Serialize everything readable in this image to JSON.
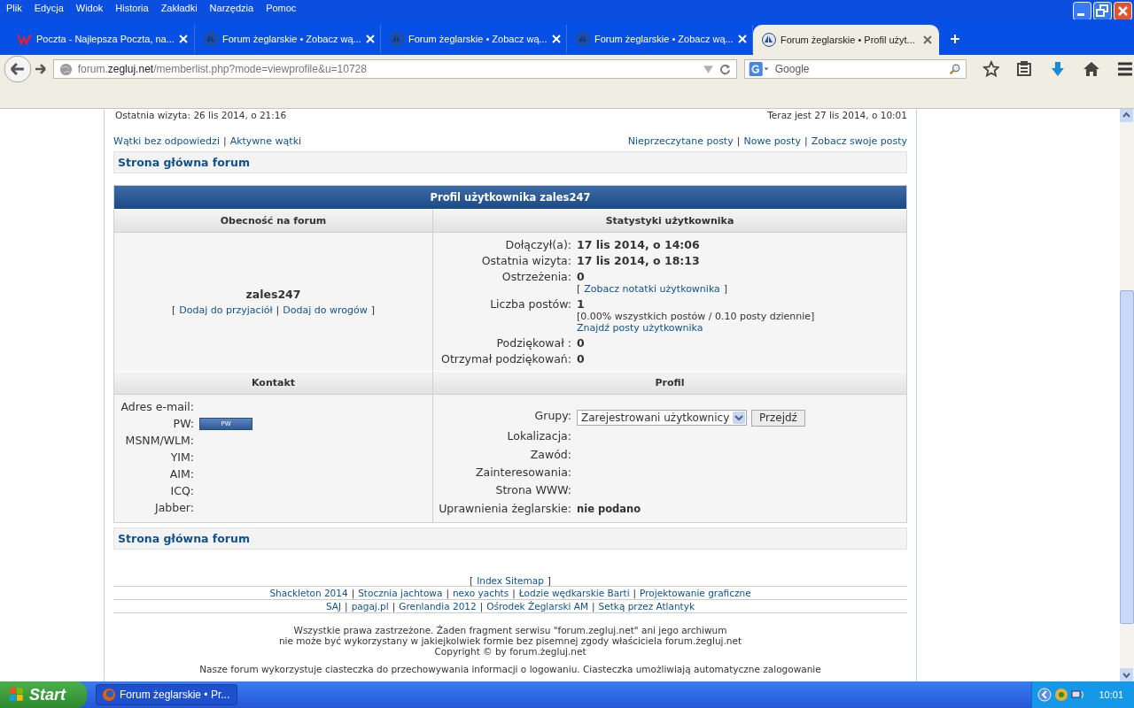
{
  "window": {
    "menu": [
      "Plik",
      "Edycja",
      "Widok",
      "Historia",
      "Zakładki",
      "Narzędzia",
      "Pomoc"
    ],
    "tabs": [
      {
        "title": "Poczta - Najlepsza Poczta, na...",
        "kind": "mail",
        "selected": false
      },
      {
        "title": "Forum żeglarskie • Zobacz wą...",
        "kind": "forum",
        "selected": false
      },
      {
        "title": "Forum żeglarskie • Zobacz wą...",
        "kind": "forum",
        "selected": false
      },
      {
        "title": "Forum żeglarskie • Zobacz wą...",
        "kind": "forum",
        "selected": false
      },
      {
        "title": "Forum żeglarskie • Profil użyt...",
        "kind": "forum",
        "selected": true
      }
    ],
    "address": {
      "prefix": "forum.",
      "domain": "zegluj.net",
      "rest": "/memberlist.php?mode=viewprofile&u=10728"
    },
    "search": {
      "placeholder": "Google"
    }
  },
  "page": {
    "last_visit": "Ostatnia wizyta: 26 lis 2014, o 21:16",
    "now": "Teraz jest 27 lis 2014, o 10:01",
    "links_left": [
      "Wątki bez odpowiedzi",
      "Aktywne wątki"
    ],
    "links_right": [
      "Nieprzeczytane posty",
      "Nowe posty",
      "Zobacz swoje posty"
    ],
    "separator": "|",
    "breadcrumb": "Strona główna forum",
    "profile": {
      "title": "Profil użytkownika zales247",
      "presence_header": "Obecność na forum",
      "stats_header": "Statystyki użytkownika",
      "username": "zales247",
      "user_links": [
        {
          "text": "[",
          "link": false
        },
        {
          "text": "Dodaj do przyjaciół",
          "link": true
        },
        {
          "text": "|",
          "link": false
        },
        {
          "text": "Dodaj do wrogów",
          "link": true
        },
        {
          "text": "]",
          "link": false
        }
      ],
      "stats": [
        {
          "label": "Dołączył(a):",
          "value": "17 lis 2014, o 14:06"
        },
        {
          "label": "Ostatnia wizyta:",
          "value": "17 lis 2014, o 18:13"
        },
        {
          "label": "Ostrzeżenia:",
          "value": "0",
          "extra": [
            [
              {
                "text": "[",
                "link": false
              },
              {
                "text": "Zobacz notatki użytkownika",
                "link": true
              },
              {
                "text": "]",
                "link": false
              }
            ]
          ]
        },
        {
          "label": "Liczba postów:",
          "value": "1",
          "extra": [
            [
              {
                "text": "[0.00% wszystkich postów / 0.10 posty dziennie]",
                "link": false
              }
            ],
            [
              {
                "text": "Znajdź posty użytkownika",
                "link": true
              }
            ]
          ]
        },
        {
          "label": "Podziękował :",
          "value": "0"
        },
        {
          "label": "Otrzymał podziękowań:",
          "value": "0"
        }
      ],
      "contact_header": "Kontakt",
      "profile_header": "Profil",
      "contact": [
        {
          "label": "Adres e-mail:",
          "kind": "text"
        },
        {
          "label": "PW:",
          "kind": "pm_button",
          "value": "PW"
        },
        {
          "label": "MSNM/WLM:",
          "kind": "text"
        },
        {
          "label": "YIM:",
          "kind": "text"
        },
        {
          "label": "AIM:",
          "kind": "text"
        },
        {
          "label": "ICQ:",
          "kind": "text"
        },
        {
          "label": "Jabber:",
          "kind": "text"
        }
      ],
      "details": [
        {
          "label": "Grupy:",
          "kind": "select",
          "value": "Zarejestrowani użytkownicy",
          "button": "Przejdź"
        },
        {
          "label": "Lokalizacja:",
          "kind": "text"
        },
        {
          "label": "Zawód:",
          "kind": "text"
        },
        {
          "label": "Zainteresowania:",
          "kind": "text"
        },
        {
          "label": "Strona WWW:",
          "kind": "text"
        },
        {
          "label": "Uprawnienia żeglarskie:",
          "kind": "text",
          "value": "nie podano"
        }
      ]
    },
    "breadcrumb_bottom": "Strona główna forum",
    "sitemap": [
      {
        "text": "[",
        "link": false
      },
      {
        "text": "Index Sitemap",
        "link": true
      },
      {
        "text": "]",
        "link": false
      }
    ],
    "partner_rows": [
      [
        "Shackleton 2014",
        "Stocznia jachtowa",
        "nexo yachts",
        "Łodzie wędkarskie Barti",
        "Projektowanie graficzne"
      ],
      [
        "SAJ",
        "pagaj.pl",
        "Grenlandia 2012",
        "Ośrodek Żeglarski AM",
        "Setką przez Atlantyk"
      ]
    ],
    "copyright": [
      "Wszystkie prawa zastrzeżone. Żaden fragment serwisu \"forum.zegluj.net\" ani jego archiwum",
      "nie może być wykorzystany w jakiejkolwiek formie bez pisemnej zgody właściciela forum.żegluj.net",
      "Copyright © by forum.żegluj.net"
    ],
    "cookies": "Nasze forum wykorzystuje ciasteczka do przechowywania informacji o logowaniu. Ciasteczka umożliwiają automatyczne zalogowanie"
  },
  "taskbar": {
    "start": "Start",
    "task": "Forum żeglarskie • Pr...",
    "clock": "10:01"
  }
}
